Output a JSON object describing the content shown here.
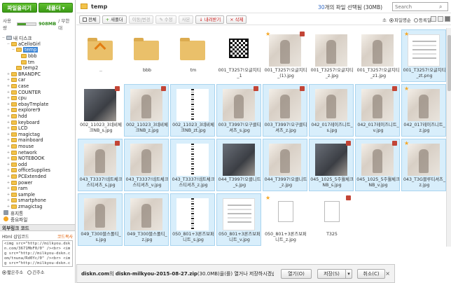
{
  "left": {
    "upload_button": "파일올리기",
    "new_folder_button": "새폴더",
    "new_folder_arrow": "▾",
    "usage_label": "사용량",
    "usage_size": "908MB",
    "usage_right": "/ 무한대",
    "usage_fraction": 0.45,
    "tree": [
      {
        "label": "내 디스크",
        "indent": 0,
        "toggle": "−",
        "icon": "hdd"
      },
      {
        "label": "aCelloGirl",
        "indent": 1,
        "toggle": "−",
        "icon": "folder"
      },
      {
        "label": "temp",
        "indent": 2,
        "toggle": "−",
        "icon": "folder",
        "selected": true
      },
      {
        "label": "bbb",
        "indent": 3,
        "toggle": "",
        "icon": "folder"
      },
      {
        "label": "tm",
        "indent": 3,
        "toggle": "",
        "icon": "folder"
      },
      {
        "label": "temp2",
        "indent": 2,
        "toggle": "",
        "icon": "folder"
      },
      {
        "label": "BRANDPC",
        "indent": 1,
        "toggle": "+",
        "icon": "folder"
      },
      {
        "label": "car",
        "indent": 1,
        "toggle": "+",
        "icon": "folder"
      },
      {
        "label": "case",
        "indent": 1,
        "toggle": "+",
        "icon": "folder"
      },
      {
        "label": "COUNTER",
        "indent": 1,
        "toggle": "+",
        "icon": "folder"
      },
      {
        "label": "cpu",
        "indent": 1,
        "toggle": "+",
        "icon": "folder"
      },
      {
        "label": "ebayTmplate",
        "indent": 1,
        "toggle": "+",
        "icon": "folder"
      },
      {
        "label": "explorer9",
        "indent": 1,
        "toggle": "+",
        "icon": "folder"
      },
      {
        "label": "hdd",
        "indent": 1,
        "toggle": "+",
        "icon": "folder"
      },
      {
        "label": "keyboard",
        "indent": 1,
        "toggle": "+",
        "icon": "folder"
      },
      {
        "label": "LCD",
        "indent": 1,
        "toggle": "+",
        "icon": "folder"
      },
      {
        "label": "magictag",
        "indent": 1,
        "toggle": "+",
        "icon": "folder"
      },
      {
        "label": "mainboard",
        "indent": 1,
        "toggle": "+",
        "icon": "folder"
      },
      {
        "label": "mouse",
        "indent": 1,
        "toggle": "+",
        "icon": "folder"
      },
      {
        "label": "network",
        "indent": 1,
        "toggle": "+",
        "icon": "folder"
      },
      {
        "label": "NOTEBOOK",
        "indent": 1,
        "toggle": "+",
        "icon": "folder"
      },
      {
        "label": "odd",
        "indent": 1,
        "toggle": "+",
        "icon": "folder"
      },
      {
        "label": "officeSupplies",
        "indent": 1,
        "toggle": "+",
        "icon": "folder"
      },
      {
        "label": "PCExtended",
        "indent": 1,
        "toggle": "+",
        "icon": "folder"
      },
      {
        "label": "power",
        "indent": 1,
        "toggle": "+",
        "icon": "folder"
      },
      {
        "label": "ram",
        "indent": 1,
        "toggle": "+",
        "icon": "folder"
      },
      {
        "label": "sample",
        "indent": 1,
        "toggle": "+",
        "icon": "folder"
      },
      {
        "label": "smartphone",
        "indent": 1,
        "toggle": "+",
        "icon": "folder"
      },
      {
        "label": "zmagictag",
        "indent": 1,
        "toggle": "+",
        "icon": "folder"
      }
    ],
    "trash_label": "휴지통",
    "important_label": "중요파일",
    "embed_title": "외부링크 코드",
    "embed_sub_left": "Html 삽입코드",
    "embed_copy": "코드복사",
    "embed_code": "<img src=\"http://milkyou.dskn.com/3671MbF0/0\" /><br> <img src=\"http://milkyou-dskn.com/tnuna/Rd0Yc/0\" /><br> <img src=\"http://milkyou-dskn.com/tnun/R/ZUrX/0\" /><br>",
    "radio_1": "짧은주소",
    "radio_2": "긴주소"
  },
  "right": {
    "folder_name": "temp",
    "selection_count": "30",
    "selection_text": "개의 파일 선택됨 (30MB)",
    "search_placeholder": "Search",
    "toolbar": {
      "select_all": "전체",
      "new_folder": "새폴더",
      "move": "이동|변경",
      "edit": "수정",
      "copy": "사본",
      "download": "내려받기",
      "delete": "삭제"
    },
    "sort_label": "소",
    "sort_1": "파일명순",
    "sort_2": "등록일",
    "files": [
      {
        "name": "..",
        "kind": "folder-up",
        "star": false,
        "tag": false,
        "sel": false
      },
      {
        "name": "bbb",
        "kind": "folder",
        "star": false,
        "tag": false,
        "sel": false
      },
      {
        "name": "tm",
        "kind": "folder",
        "star": false,
        "tag": false,
        "sel": false
      },
      {
        "name": "001_T3257!오글지티_1",
        "kind": "qr",
        "star": false,
        "tag": false,
        "sel": false
      },
      {
        "name": "001_T3257!오글지티_(1).jpg",
        "kind": "photo",
        "star": true,
        "tag": true,
        "sel": false
      },
      {
        "name": "001_T3257!오글지티_z.jpg",
        "kind": "photo",
        "star": false,
        "tag": false,
        "sel": false
      },
      {
        "name": "001_T3257!오글지티_z1.jpg",
        "kind": "photo",
        "star": false,
        "tag": false,
        "sel": false
      },
      {
        "name": "001_T3257!오글지티_zt.png",
        "kind": "doc",
        "star": true,
        "tag": false,
        "sel": true
      },
      {
        "name": "002_11023_3네비체크NB_s.jpg",
        "kind": "dark",
        "star": false,
        "tag": true,
        "sel": false
      },
      {
        "name": "002_11023_3네비체크NB_z.jpg",
        "kind": "photo",
        "star": false,
        "tag": true,
        "sel": true
      },
      {
        "name": "002_11023_3네비체크NB_zt.jpg",
        "kind": "strip",
        "star": false,
        "tag": false,
        "sel": true
      },
      {
        "name": "003_T3997!오구클티셔츠_s.jpg",
        "kind": "photo",
        "star": false,
        "tag": true,
        "sel": true
      },
      {
        "name": "003_T3997!오구클티셔츠_z.jpg",
        "kind": "photo",
        "star": false,
        "tag": true,
        "sel": true
      },
      {
        "name": "042_017레이즈니트_s.jpg",
        "kind": "photo",
        "star": false,
        "tag": false,
        "sel": true
      },
      {
        "name": "042_017레이즈니트_v.jpg",
        "kind": "photo",
        "star": false,
        "tag": true,
        "sel": true
      },
      {
        "name": "042_017레이즈니트_z.jpg",
        "kind": "photo",
        "star": true,
        "tag": false,
        "sel": true
      },
      {
        "name": "043_T3337!네트체크스티셔츠_s.jpg",
        "kind": "photo",
        "star": false,
        "tag": true,
        "sel": true
      },
      {
        "name": "043_T3337!네트체크스티셔츠_v.jpg",
        "kind": "photo",
        "star": false,
        "tag": false,
        "sel": true
      },
      {
        "name": "043_T3337!네트체크스티셔츠_z.jpg",
        "kind": "strip",
        "star": false,
        "tag": false,
        "sel": true
      },
      {
        "name": "044_T3997!오클니트_s.jpg",
        "kind": "dark",
        "star": false,
        "tag": false,
        "sel": true
      },
      {
        "name": "044_T3997!오클니트_z.jpg",
        "kind": "photo",
        "star": false,
        "tag": false,
        "sel": true
      },
      {
        "name": "045_1025_5주월체크NB_s.jpg",
        "kind": "dark",
        "star": false,
        "tag": true,
        "sel": true
      },
      {
        "name": "045_1025_5주월체크NB_v.jpg",
        "kind": "photo",
        "star": false,
        "tag": true,
        "sel": true
      },
      {
        "name": "043_T3G블루티셔츠_z.jpg",
        "kind": "photo",
        "star": true,
        "tag": false,
        "sel": true
      },
      {
        "name": "049_T300블스폴티_s.jpg",
        "kind": "photo",
        "star": false,
        "tag": false,
        "sel": true
      },
      {
        "name": "049_T300블스폴티_z.jpg",
        "kind": "photo",
        "star": false,
        "tag": false,
        "sel": true
      },
      {
        "name": "050_801+3론즈보퍼니트_s.jpg",
        "kind": "strip",
        "star": false,
        "tag": false,
        "sel": true
      },
      {
        "name": "050_801+3론즈보퍼니트_v.jpg",
        "kind": "doc",
        "star": false,
        "tag": false,
        "sel": true
      },
      {
        "name": "050_801+3론즈보퍼니트_z.jpg",
        "kind": "blank",
        "star": true,
        "tag": false,
        "sel": false
      },
      {
        "name": "T325",
        "kind": "blank",
        "star": false,
        "tag": true,
        "sel": false
      }
    ]
  },
  "download_bar": {
    "site": "diskn.com",
    "middle": "의 ",
    "file": "diskn-milkyou-2015-08-27.zip",
    "rest": "(30.0MB)을(를) 열거나 저장하시겠습니까?",
    "open": "열기(O)",
    "save": "저장(S)",
    "save_arrow": "▾",
    "cancel": "취소(C)",
    "close": "×"
  },
  "colors": {
    "accent_green": "#3c9a16",
    "selection_blue": "#d8eefb",
    "delete_red": "#c8201e",
    "count_blue": "#3168c4"
  }
}
